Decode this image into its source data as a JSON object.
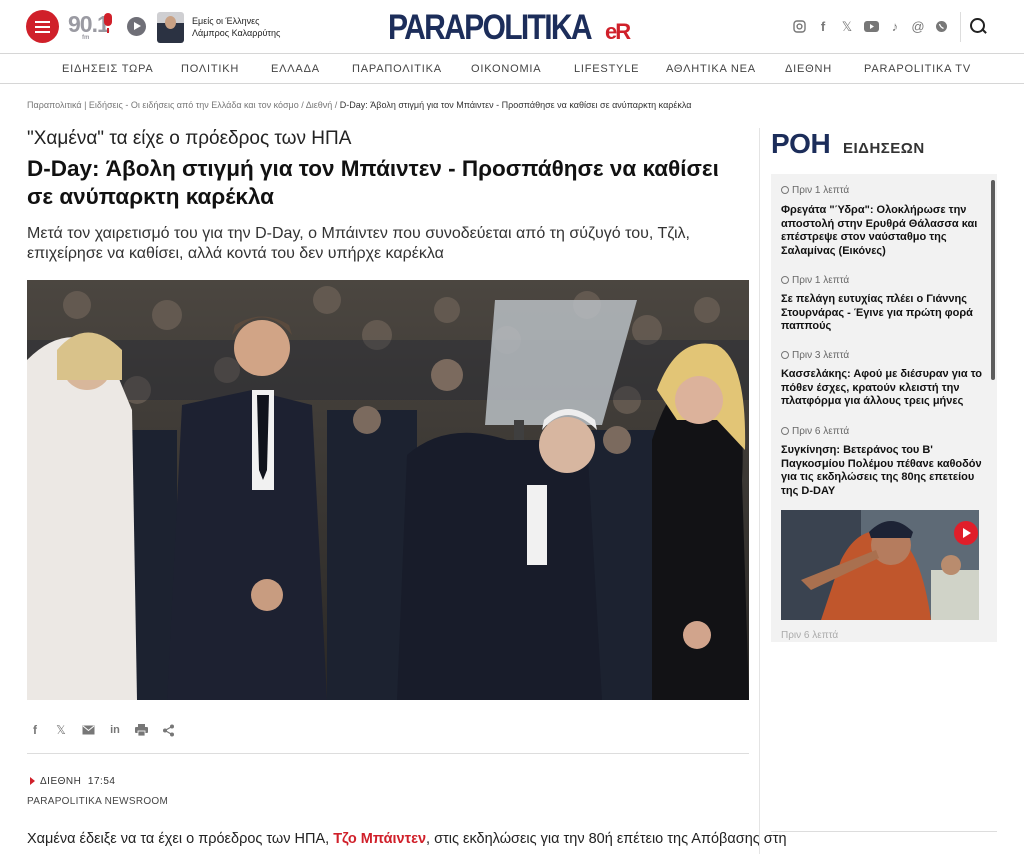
{
  "header": {
    "radio_logo": "90.1",
    "radio_sub": "fm",
    "show_line1": "Εμείς οι Έλληνες",
    "show_line2": "Λάμπρος Καλαρρύτης",
    "logo": "PARAPOLITIKA",
    "logo_suffix": "eR",
    "accent": "#d0202a",
    "brand_navy": "#1c2d5a",
    "social_icons": [
      "instagram-icon",
      "facebook-icon",
      "x-icon",
      "youtube-icon",
      "tiktok-icon",
      "threads-icon",
      "viber-icon"
    ]
  },
  "nav": [
    "ΕΙΔΗΣΕΙΣ ΤΩΡΑ",
    "ΠΟΛΙΤΙΚΗ",
    "ΕΛΛΑΔΑ",
    "ΠΑΡΑΠΟΛΙΤΙΚΑ",
    "ΟΙΚΟΝΟΜΙΑ",
    "LIFESTYLE",
    "ΑΘΛΗΤΙΚΑ ΝΕΑ",
    "ΔΙΕΘΝΗ",
    "PARAPOLITIKA TV"
  ],
  "breadcrumb": {
    "home": "Παραπολιτικά | Ειδήσεις - Οι ειδήσεις από την Ελλάδα και τον κόσμο",
    "section": "Διεθνή",
    "current": "D-Day: Άβολη στιγμή για τον Μπάιντεν - Προσπάθησε να καθίσει σε ανύπαρκτη καρέκλα"
  },
  "article": {
    "kicker": "\"Χαμένα\" τα είχε ο πρόεδρος των ΗΠΑ",
    "title": "D-Day: Άβολη στιγμή για τον Μπάιντεν - Προσπάθησε να καθίσει σε ανύπαρκτη καρέκλα",
    "lead": "Μετά τον χαιρετισμό του για την D-Day, ο Μπάιντεν που συνοδεύεται από τη σύζυγό του, Τζιλ, επιχείρησε να καθίσει, αλλά κοντά του δεν υπήρχε καρέκλα",
    "category": "ΔΙΕΘΝΗ",
    "time": "17:54",
    "author": "PARAPOLITIKA NEWSROOM",
    "body_before": "Χαμένα έδειξε να τα έχει ο πρόεδρος των ΗΠΑ, ",
    "body_link": "Τζο Μπάιντεν",
    "body_after": ", στις εκδηλώσεις για την 80ή επέτειο της Απόβασης στη"
  },
  "share_icons": [
    "facebook-icon",
    "x-icon",
    "email-icon",
    "linkedin-icon",
    "print-icon",
    "share-icon"
  ],
  "news_feed": {
    "title_main": "ΡΟΗ",
    "title_sub": "ΕΙΔΗΣΕΩΝ",
    "items": [
      {
        "time": "Πριν 1 λεπτά",
        "title": "Φρεγάτα \"Ύδρα\": Ολοκλήρωσε την αποστολή στην Ερυθρά Θάλασσα και επέστρεψε στον ναύσταθμο της Σαλαμίνας (Εικόνες)"
      },
      {
        "time": "Πριν 1 λεπτά",
        "title": "Σε πελάγη ευτυχίας πλέει ο Γιάννης Στουρνάρας - Έγινε για πρώτη φορά παππούς"
      },
      {
        "time": "Πριν 3 λεπτά",
        "title": "Κασσελάκης: Αφού με διέσυραν για το πόθεν έσχες, κρατούν κλειστή την πλατφόρμα για άλλους τρεις μήνες"
      },
      {
        "time": "Πριν 6 λεπτά",
        "title": "Συγκίνηση: Βετεράνος του Β' Παγκοσμίου Πολέμου πέθανε καθοδόν για τις εκδηλώσεις της 80ης επετείου της D-DAY"
      }
    ],
    "next_time": "Πριν 6 λεπτά"
  }
}
